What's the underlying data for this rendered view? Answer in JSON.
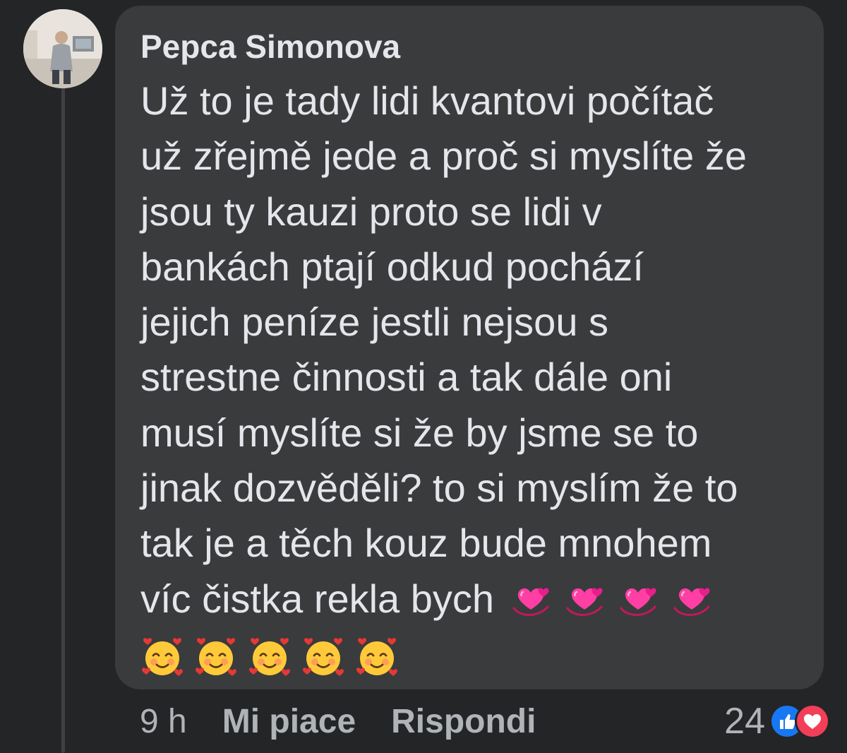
{
  "comment": {
    "author": "Pepca Simonova",
    "avatar_alt": "avatar",
    "lines": [
      "Už to je tady lidi kvantovi počítač",
      "už zřejmě jede a proč si myslíte že",
      "jsou ty kauzi proto se lidi v",
      "bankách ptají odkud pochází",
      "jejich peníze jestli nejsou s",
      "strestne činnosti a tak dále oni",
      "musí myslíte si že by jsme se to",
      "jinak dozvěděli? to si myslím že to",
      "tak je a těch kouz bude mnohem",
      "víc čistka rekla bych"
    ],
    "emoji_line_1": [
      "revolving-hearts",
      "revolving-hearts",
      "revolving-hearts",
      "revolving-hearts"
    ],
    "emoji_line_2": [
      "smiling-face-with-hearts",
      "smiling-face-with-hearts",
      "smiling-face-with-hearts",
      "smiling-face-with-hearts",
      "smiling-face-with-hearts"
    ]
  },
  "footer": {
    "time": "9 h",
    "like_label": "Mi piace",
    "reply_label": "Rispondi",
    "reaction_count": "24",
    "reaction_icons": [
      "like-icon",
      "love-icon"
    ]
  },
  "colors": {
    "background": "#242526",
    "bubble": "#3a3b3c",
    "text": "#e4e6eb",
    "secondary_text": "#b0b3b8",
    "like_blue": "#1877f2",
    "love_red": "#f33e58"
  }
}
